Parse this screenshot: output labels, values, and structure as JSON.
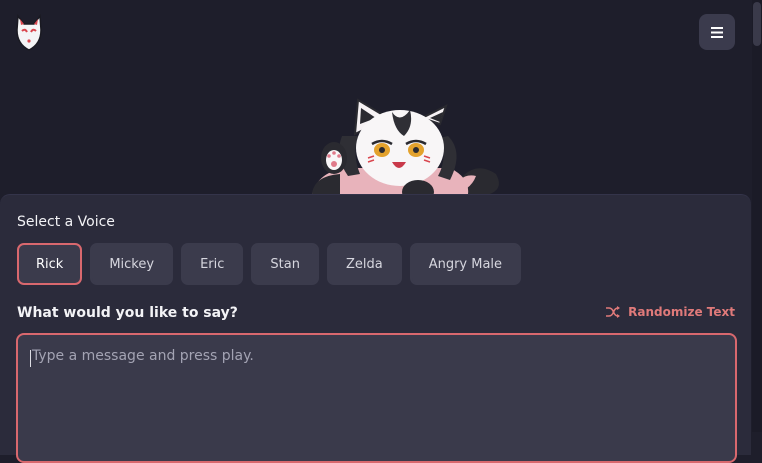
{
  "header": {
    "logo_icon": "kitsune-mask-logo",
    "menu_icon": "hamburger-menu-icon"
  },
  "mascot": {
    "icon": "waving-fox-mascot"
  },
  "voice_section": {
    "label": "Select a Voice",
    "selected": "Rick",
    "voices": [
      "Rick",
      "Mickey",
      "Eric",
      "Stan",
      "Zelda",
      "Angry Male"
    ]
  },
  "message_section": {
    "label": "What would you like to say?",
    "randomize_label": "Randomize Text",
    "randomize_icon": "shuffle-icon",
    "placeholder": "Type a message and press play.",
    "value": ""
  },
  "colors": {
    "background": "#1e1e2b",
    "panel": "#2b2b3b",
    "button": "#3b3b4c",
    "accent": "#d9686e"
  }
}
